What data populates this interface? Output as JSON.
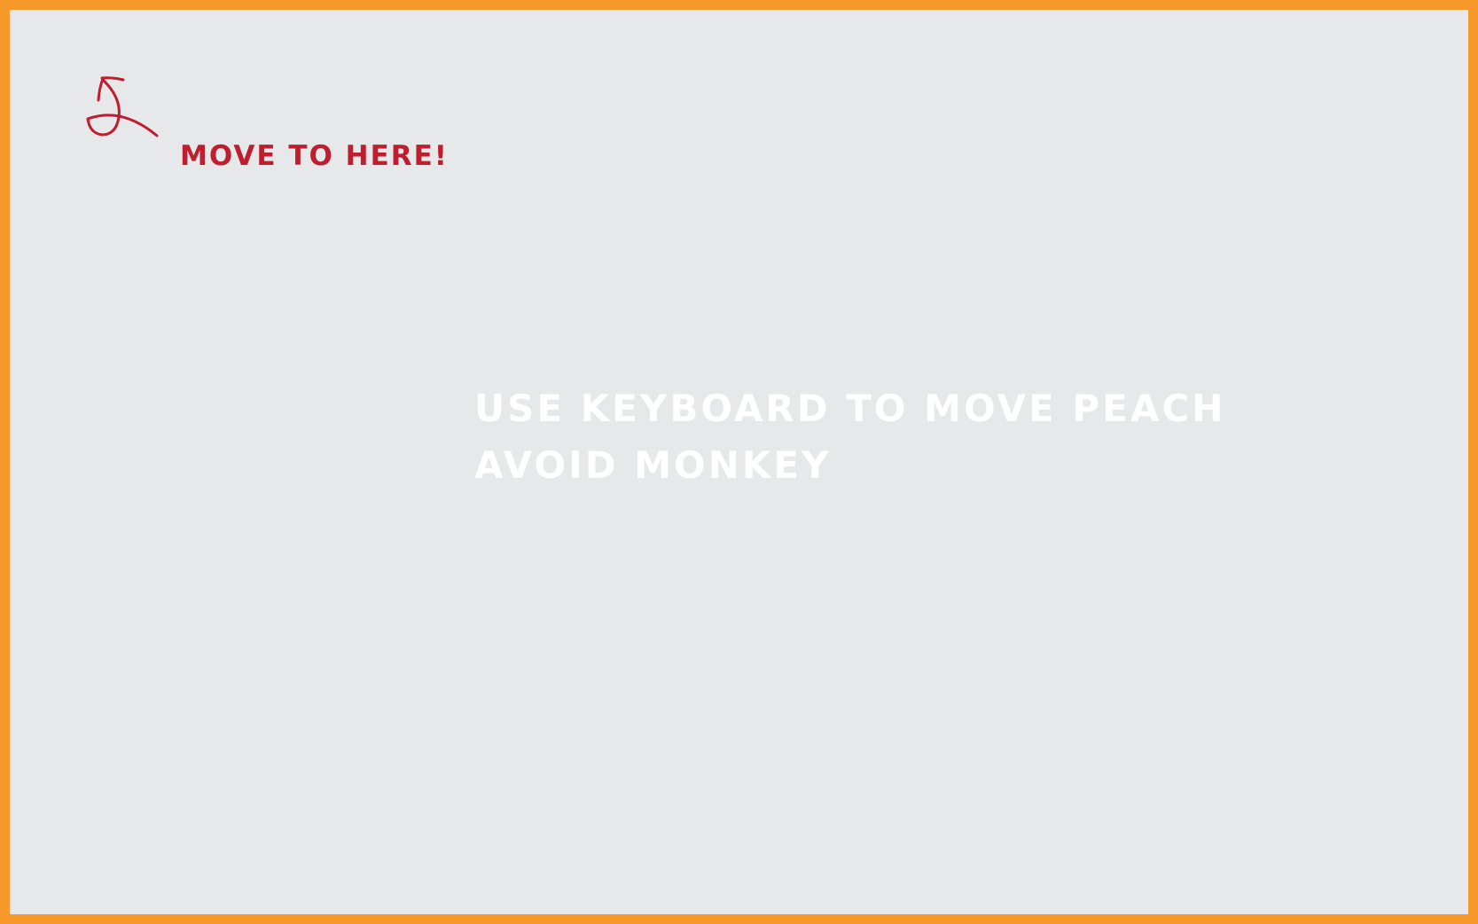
{
  "game": {
    "goal": {
      "label": "MOVE TO HERE!",
      "icon": "cherry-icon",
      "color": "#be1e2d"
    },
    "instructions": [
      "USE KEYBOARD TO MOVE PEACH",
      "AVOID MONKEY"
    ],
    "colors": {
      "border": "#f7982b",
      "background": "#e7e8ea",
      "instruction_text": "#ffffff"
    }
  }
}
